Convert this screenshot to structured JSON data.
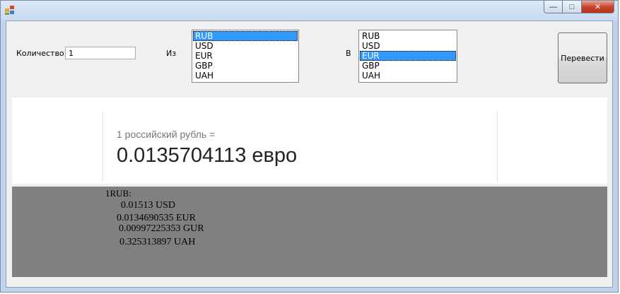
{
  "window": {
    "title": "",
    "buttons": {
      "minimize": "—",
      "maximize": "□",
      "close": "✕"
    }
  },
  "form": {
    "quantity_label": "Количество",
    "quantity_value": "1",
    "from_label": "Из",
    "to_label": "В",
    "from_list": {
      "items": [
        "RUB",
        "USD",
        "EUR",
        "GBP",
        "UAH"
      ],
      "selected": "RUB"
    },
    "to_list": {
      "items": [
        "RUB",
        "USD",
        "EUR",
        "GBP",
        "UAH"
      ],
      "selected": "EUR"
    },
    "convert_label": "Перевести"
  },
  "result": {
    "caption": "1 российский рубль =",
    "value": "0.0135704113 евро"
  },
  "rates": {
    "header": "1RUB:",
    "rows": [
      "0.01513 USD",
      "0.0134690535 EUR",
      "0.00997225353 GUR",
      "0.325313897 UAH"
    ]
  },
  "colors": {
    "selection": "#3399ff",
    "rates_panel": "#808080",
    "client_bg": "#f0f0f0"
  },
  "icons": [
    "app-icon",
    "minimize-icon",
    "maximize-icon",
    "close-icon"
  ]
}
